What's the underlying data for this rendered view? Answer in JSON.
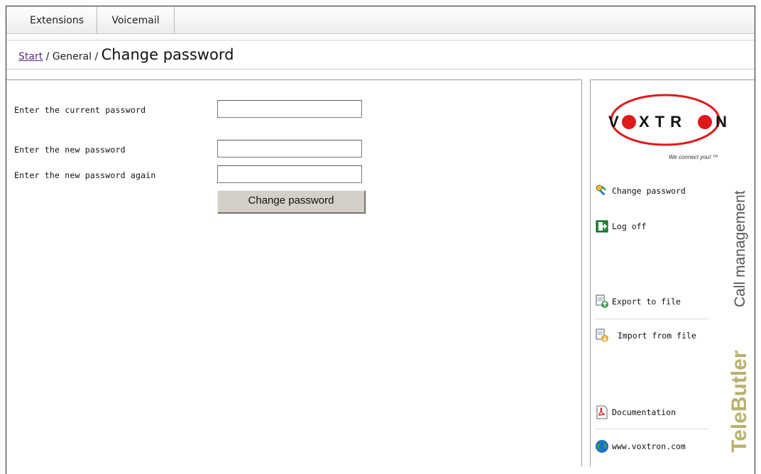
{
  "tabs": [
    {
      "label": "Extensions"
    },
    {
      "label": "Voicemail"
    }
  ],
  "breadcrumb": {
    "start": "Start",
    "separator": " / ",
    "general": "General",
    "title": "Change password"
  },
  "form": {
    "current_label": "Enter the current password",
    "current_value": "",
    "new_label": "Enter the new password",
    "new_value": "",
    "again_label": "Enter the new password again",
    "again_value": "",
    "submit_label": "Change password"
  },
  "sidebar": {
    "logo_text": "VOXTRON",
    "slogan": "We connect you! ™",
    "links": [
      {
        "label": "Change password",
        "icon": "key-icon"
      },
      {
        "label": "Log off",
        "icon": "exit-icon"
      },
      {
        "label": "Export to file",
        "icon": "export-icon"
      },
      {
        "label": "Import from file",
        "icon": "import-icon"
      },
      {
        "label": "Documentation",
        "icon": "pdf-icon"
      },
      {
        "label": "www.voxtron.com",
        "icon": "globe-icon"
      }
    ],
    "brand": "TeleButler",
    "product": "Call management"
  },
  "colors": {
    "link": "#5a2a85",
    "brand_olive": "#b9b16e",
    "logo_red": "#e0191b"
  }
}
